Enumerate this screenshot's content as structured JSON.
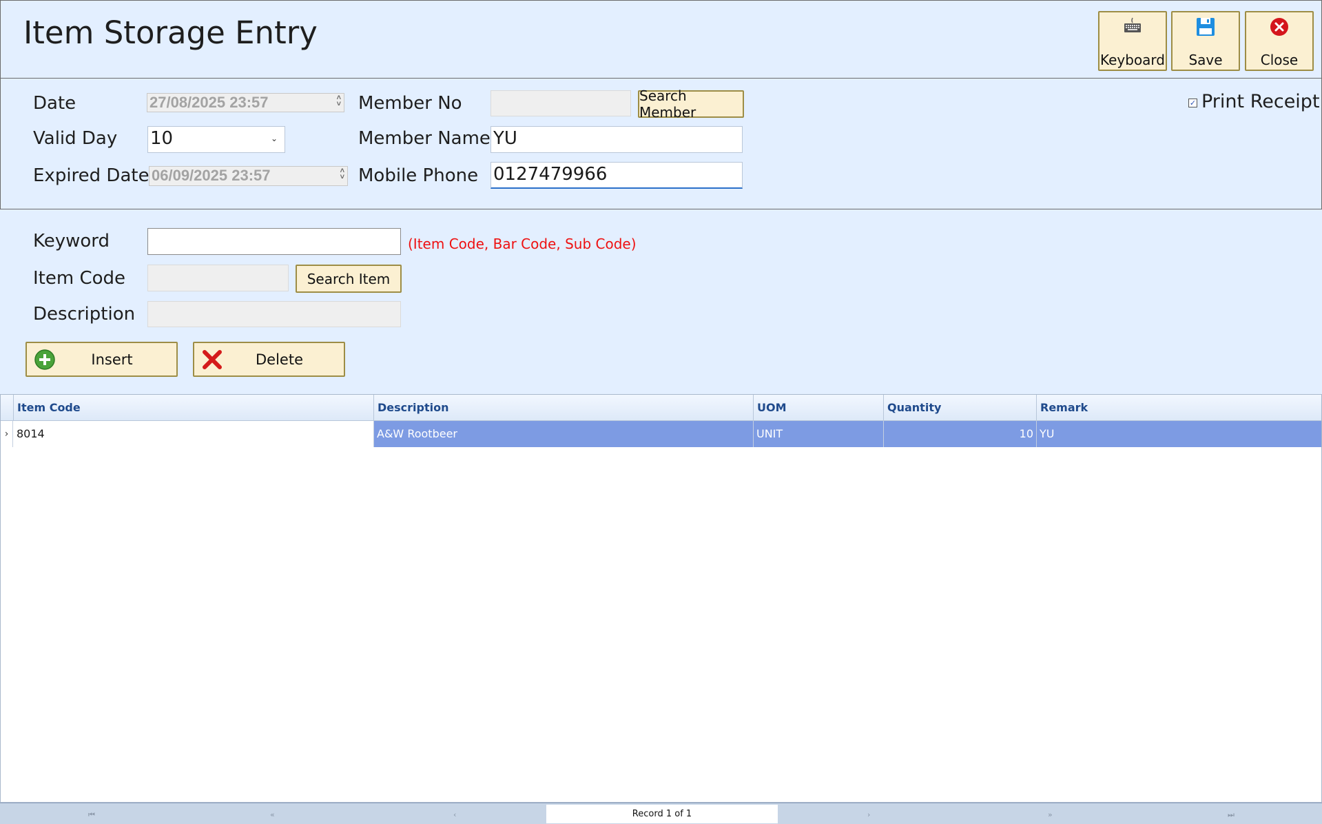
{
  "header": {
    "title": "Item Storage Entry"
  },
  "toolbar": {
    "keyboard": {
      "label": "Keyboard",
      "icon": "keyboard-icon"
    },
    "save": {
      "label": "Save",
      "icon": "floppy-disk-icon"
    },
    "close": {
      "label": "Close",
      "icon": "close-circle-icon"
    }
  },
  "member": {
    "date_label": "Date",
    "date_value": "27/08/2025 23:57",
    "valid_day_label": "Valid Day",
    "valid_day_value": "10",
    "expired_label": "Expired Date",
    "expired_value": "06/09/2025 23:57",
    "member_no_label": "Member No",
    "member_no_value": "",
    "search_member": "Search Member",
    "member_name_label": "Member Name",
    "member_name_value": "YU",
    "mobile_label": "Mobile Phone",
    "mobile_value": "0127479966",
    "print_receipt_label": "Print Receipt",
    "print_receipt_checked": true
  },
  "item": {
    "keyword_label": "Keyword",
    "keyword_value": "",
    "keyword_hint": "(Item Code, Bar Code, Sub Code)",
    "item_code_label": "Item Code",
    "item_code_value": "",
    "search_item": "Search Item",
    "description_label": "Description",
    "description_value": "",
    "insert_label": "Insert",
    "delete_label": "Delete"
  },
  "grid": {
    "columns": [
      "Item Code",
      "Description",
      "UOM",
      "Quantity",
      "Remark"
    ],
    "rows": [
      {
        "item_code": "8014",
        "description": "A&W Rootbeer",
        "uom": "UNIT",
        "quantity": "10",
        "remark": "YU"
      }
    ],
    "record_text": "Record 1 of 1"
  },
  "colors": {
    "accent_red": "#e11111",
    "selection": "#7d9be3",
    "panel": "#e3efff",
    "button": "#fbf0d2"
  }
}
